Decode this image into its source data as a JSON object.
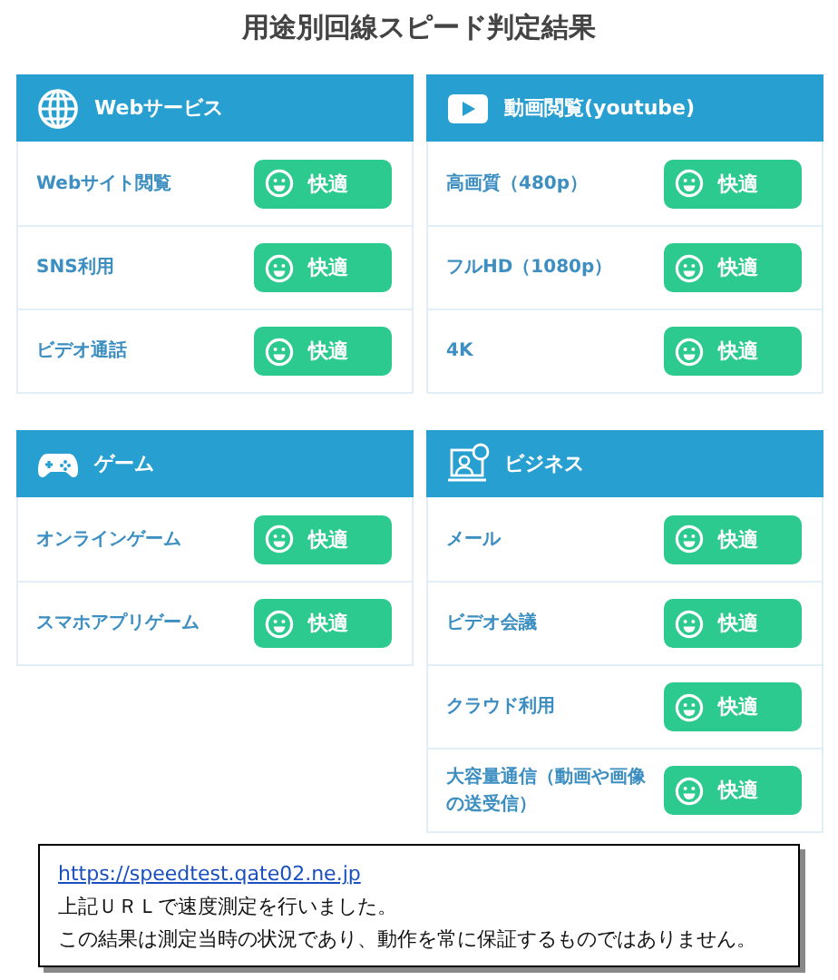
{
  "title": "用途別回線スピード判定結果",
  "categories": [
    {
      "name": "Webサービス",
      "kind": "globe",
      "items": [
        {
          "label": "Webサイト閲覧",
          "result": "快適"
        },
        {
          "label": "SNS利用",
          "result": "快適"
        },
        {
          "label": "ビデオ通話",
          "result": "快適"
        }
      ]
    },
    {
      "name": "動画閲覧(youtube)",
      "kind": "video",
      "items": [
        {
          "label": "高画質（480p）",
          "result": "快適"
        },
        {
          "label": "フルHD（1080p）",
          "result": "快適"
        },
        {
          "label": "4K",
          "result": "快適"
        }
      ]
    },
    {
      "name": "ゲーム",
      "kind": "gamepad",
      "items": [
        {
          "label": "オンラインゲーム",
          "result": "快適"
        },
        {
          "label": "スマホアプリゲーム",
          "result": "快適"
        }
      ]
    },
    {
      "name": "ビジネス",
      "kind": "meeting",
      "items": [
        {
          "label": "メール",
          "result": "快適"
        },
        {
          "label": "ビデオ会議",
          "result": "快適"
        },
        {
          "label": "クラウド利用",
          "result": "快適"
        },
        {
          "label": "大容量通信（動画や画像の送受信）",
          "result": "快適"
        }
      ]
    }
  ],
  "note": {
    "link": "https://speedtest.qate02.ne.jp",
    "lines": [
      "上記ＵＲＬで速度測定を行いました。",
      "この結果は測定当時の状況であり、動作を常に保証するものではありません。"
    ]
  }
}
